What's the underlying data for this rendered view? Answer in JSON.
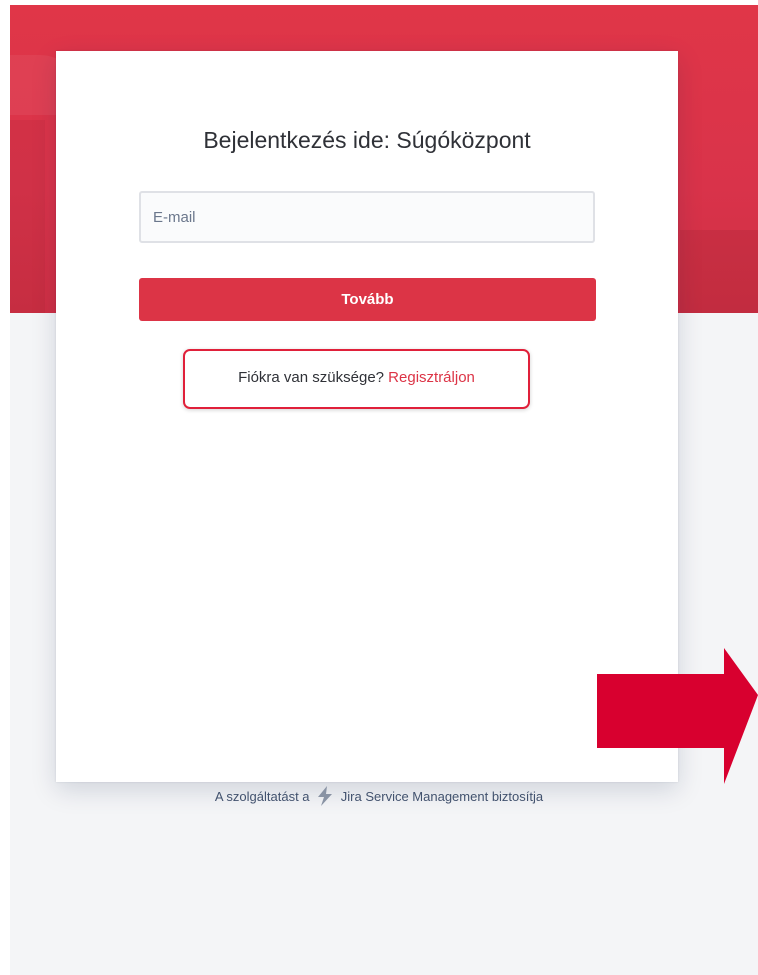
{
  "login": {
    "title": "Bejelentkezés ide: Súgóközpont",
    "email": {
      "placeholder": "E-mail",
      "value": ""
    },
    "next_label": "Tovább",
    "signup_prompt": "Fiókra van szüksége?",
    "signup_link": "Regisztráljon"
  },
  "footer": {
    "prefix": "A szolgáltatást a",
    "product": "Jira Service Management",
    "suffix": "biztosítja",
    "logo_icon": "jira-service-management-logo-icon"
  },
  "colors": {
    "brand": "#dc3446",
    "highlight_border": "#e0203a",
    "arrow": "#d8002f",
    "page_background": "#f4f5f7"
  },
  "annotation": {
    "arrow_icon": "arrow-right-icon"
  }
}
